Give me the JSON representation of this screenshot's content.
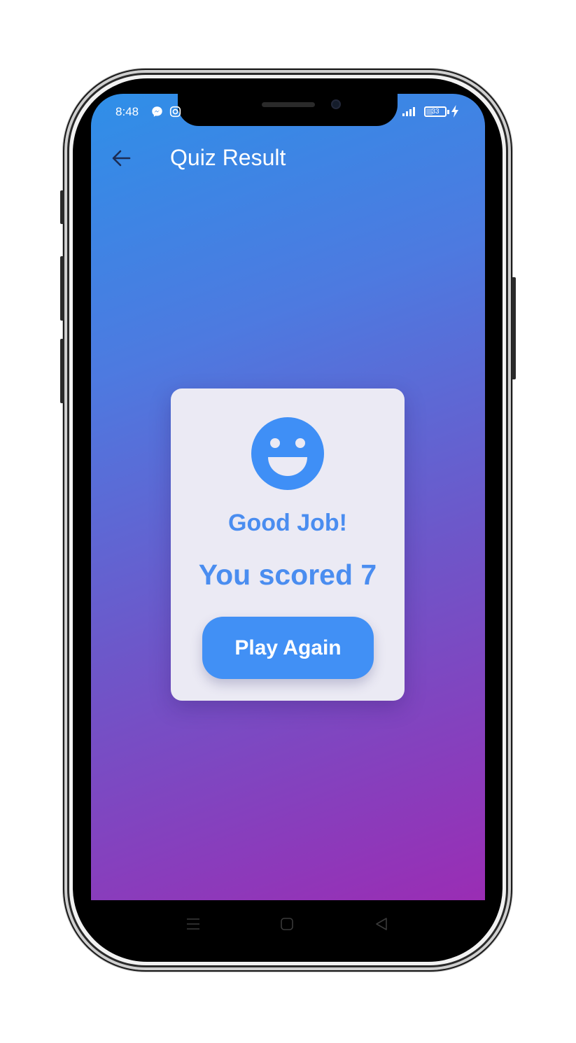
{
  "status_bar": {
    "time": "8:48",
    "app_icons": [
      "messenger-icon",
      "instagram-icon"
    ],
    "battery_level": 33,
    "battery_text": "33",
    "charging": true
  },
  "header": {
    "back_icon": "arrow-left-icon",
    "title": "Quiz Result"
  },
  "result_card": {
    "icon": "smiley-face-icon",
    "message": "Good Job!",
    "score_text": "You scored 7",
    "button_label": "Play Again"
  },
  "navigation_bar": {
    "buttons": [
      "menu-icon",
      "home-icon",
      "back-triangle-icon"
    ]
  },
  "colors": {
    "gradient_start": "#2f8fe8",
    "gradient_end": "#9a2db4",
    "accent": "#4190f5",
    "card_background": "#ebeaf4"
  }
}
